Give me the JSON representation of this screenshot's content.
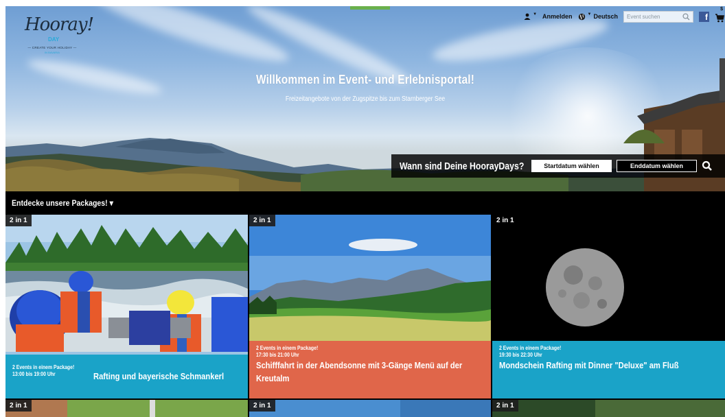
{
  "header": {
    "logo": {
      "script": "Hooray!",
      "day": "DAY",
      "tagline": "— CREATE YOUR HOLIDAY —",
      "region": "IN BAVARIA"
    },
    "login_label": "Anmelden",
    "language_label": "Deutsch",
    "search_placeholder": "Event suchen",
    "facebook_label": "f",
    "cart_count": "$"
  },
  "hero": {
    "title": "Willkommen im Event- und Erlebnisportal!",
    "subtitle": "Freizeitangebote von der Zugspitze bis zum Starnberger See"
  },
  "date_bar": {
    "question": "Wann sind Deine HoorayDays?",
    "start_label": "Startdatum wählen",
    "end_label": "Enddatum wählen"
  },
  "section": {
    "title": "Entdecke unsere Packages! ▾"
  },
  "packages": [
    {
      "badge": "2 in 1",
      "line1": "2 Events in einem Package!",
      "line2": "13:00 bis 19:00 Uhr",
      "title": "Rafting und bayerische Schmankerl",
      "color": "#1aa3c8"
    },
    {
      "badge": "2 in 1",
      "line1": "2 Events in einem Package!",
      "line2": "17:30 bis 21:00 Uhr",
      "title": "Schifffahrt in der Abendsonne mit 3-Gänge Menü auf der Kreutalm",
      "color": "#e0664a"
    },
    {
      "badge": "2 in 1",
      "line1": "2 Events in einem Package!",
      "line2": "19:30 bis 22:30 Uhr",
      "title": "Mondschein Rafting mit Dinner \"Deluxe\" am Fluß",
      "color": "#1aa3c8"
    },
    {
      "badge": "2 in 1"
    },
    {
      "badge": "2 in 1"
    },
    {
      "badge": "2 in 1"
    }
  ]
}
